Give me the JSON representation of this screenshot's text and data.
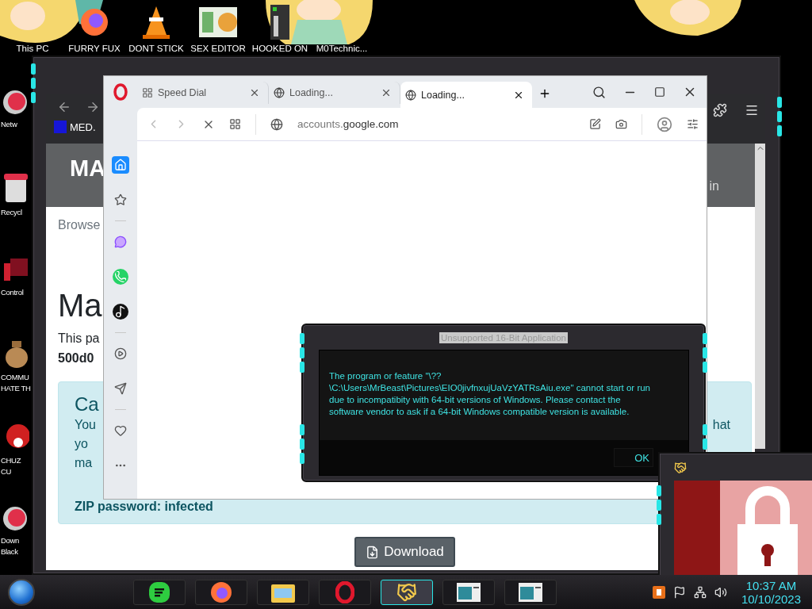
{
  "desktop": {
    "top_icons": [
      {
        "label": "This PC",
        "kind": "hidden"
      },
      {
        "label": "FURRY FUX",
        "kind": "firefox"
      },
      {
        "label": "DONT STICK",
        "kind": "cone"
      },
      {
        "label": "SEX EDITOR",
        "kind": "hex"
      },
      {
        "label": "HOOKED ON",
        "kind": "app"
      },
      {
        "label": "M0Technic...",
        "kind": "hidden"
      }
    ],
    "side_icons": [
      {
        "label": "Netw",
        "kind": "orb"
      },
      {
        "label": "Recycl",
        "kind": "bin"
      },
      {
        "label": "Control",
        "kind": "panel"
      },
      {
        "label": "COMMU\nHATE TH",
        "kind": "bag"
      },
      {
        "label": "CHUZ\nCU",
        "kind": "blob"
      },
      {
        "label": "Down\nBlack",
        "kind": "orb"
      }
    ]
  },
  "back_browser": {
    "bookmark": "MED.",
    "site_title": "MA",
    "header_link": "in",
    "breadcrumb": "Browse",
    "heading": "Ma",
    "intro": "This pa",
    "hash": "500d0",
    "card": {
      "title": "Ca",
      "lines": [
        "You",
        "yo",
        "ma"
      ],
      "line_end": "hat",
      "zip": "ZIP password: infected"
    },
    "download_button": "Download"
  },
  "opera": {
    "tabs": [
      {
        "title": "Speed Dial",
        "kind": "speed_dial",
        "selected": false
      },
      {
        "title": "Loading...",
        "kind": "page",
        "selected": false
      },
      {
        "title": "Loading...",
        "kind": "page",
        "selected": true
      }
    ],
    "address": {
      "subdomain": "accounts.",
      "domain": "google.com"
    },
    "sidebar": [
      {
        "kind": "home",
        "selected": true
      },
      {
        "kind": "star",
        "selected": false
      },
      {
        "kind": "divider"
      },
      {
        "kind": "messenger",
        "selected": false
      },
      {
        "kind": "whatsapp",
        "selected": false
      },
      {
        "kind": "tiktok",
        "selected": false
      },
      {
        "kind": "divider"
      },
      {
        "kind": "player",
        "selected": false
      },
      {
        "kind": "send",
        "selected": false
      },
      {
        "kind": "divider"
      },
      {
        "kind": "heart",
        "selected": false
      },
      {
        "kind": "more",
        "selected": false
      }
    ]
  },
  "dialog": {
    "title": "Unsupported 16-Bit Application",
    "message": "The program or feature \"\\??\\C:\\Users\\MrBeast\\Pictures\\EIO0jivfnxujUaVzYATRsAiu.exe\" cannot start or run due to incompatibity with 64-bit versions of Windows. Please contact the software vendor to ask if a 64-bit Windows compatible version is available.",
    "ok_button": "OK"
  },
  "taskbar": {
    "apps": [
      {
        "kind": "green",
        "selected": false
      },
      {
        "kind": "firefox",
        "selected": false
      },
      {
        "kind": "folder",
        "selected": false
      },
      {
        "kind": "opera",
        "selected": false
      },
      {
        "kind": "handshake",
        "selected": true
      },
      {
        "kind": "window",
        "selected": false
      },
      {
        "kind": "window",
        "selected": false
      }
    ],
    "clock": {
      "time": "10:37 AM",
      "date": "10/10/2023"
    }
  }
}
